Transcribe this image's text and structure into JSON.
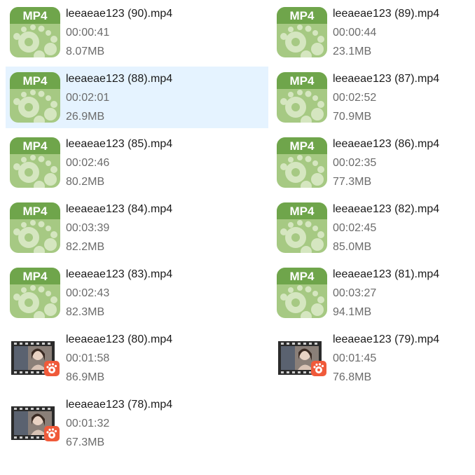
{
  "colors": {
    "mp4_band": "#6fa54b",
    "mp4_body": "#a6c983",
    "mp4_circles": "#d5e6c0",
    "selection": "#e5f3ff",
    "player_badge": "#f05a3a"
  },
  "files": [
    {
      "name": "leeaeae123 (90).mp4",
      "duration": "00:00:41",
      "size": "8.07MB",
      "icon": "mp4-file-icon",
      "badge": "MP4",
      "selected": false
    },
    {
      "name": "leeaeae123 (89).mp4",
      "duration": "00:00:44",
      "size": "23.1MB",
      "icon": "mp4-file-icon",
      "badge": "MP4",
      "selected": false
    },
    {
      "name": "leeaeae123 (88).mp4",
      "duration": "00:02:01",
      "size": "26.9MB",
      "icon": "mp4-file-icon",
      "badge": "MP4",
      "selected": true
    },
    {
      "name": "leeaeae123 (87).mp4",
      "duration": "00:02:52",
      "size": "70.9MB",
      "icon": "mp4-file-icon",
      "badge": "MP4",
      "selected": false
    },
    {
      "name": "leeaeae123 (85).mp4",
      "duration": "00:02:46",
      "size": "80.2MB",
      "icon": "mp4-file-icon",
      "badge": "MP4",
      "selected": false
    },
    {
      "name": "leeaeae123 (86).mp4",
      "duration": "00:02:35",
      "size": "77.3MB",
      "icon": "mp4-file-icon",
      "badge": "MP4",
      "selected": false
    },
    {
      "name": "leeaeae123 (84).mp4",
      "duration": "00:03:39",
      "size": "82.2MB",
      "icon": "mp4-file-icon",
      "badge": "MP4",
      "selected": false
    },
    {
      "name": "leeaeae123 (82).mp4",
      "duration": "00:02:45",
      "size": "85.0MB",
      "icon": "mp4-file-icon",
      "badge": "MP4",
      "selected": false
    },
    {
      "name": "leeaeae123 (83).mp4",
      "duration": "00:02:43",
      "size": "82.3MB",
      "icon": "mp4-file-icon",
      "badge": "MP4",
      "selected": false
    },
    {
      "name": "leeaeae123 (81).mp4",
      "duration": "00:03:27",
      "size": "94.1MB",
      "icon": "mp4-file-icon",
      "badge": "MP4",
      "selected": false
    },
    {
      "name": "leeaeae123 (80).mp4",
      "duration": "00:01:58",
      "size": "86.9MB",
      "icon": "video-thumbnail-icon",
      "badge": "",
      "selected": false
    },
    {
      "name": "leeaeae123 (79).mp4",
      "duration": "00:01:45",
      "size": "76.8MB",
      "icon": "video-thumbnail-icon",
      "badge": "",
      "selected": false
    },
    {
      "name": "leeaeae123 (78).mp4",
      "duration": "00:01:32",
      "size": "67.3MB",
      "icon": "video-thumbnail-icon",
      "badge": "",
      "selected": false
    }
  ]
}
